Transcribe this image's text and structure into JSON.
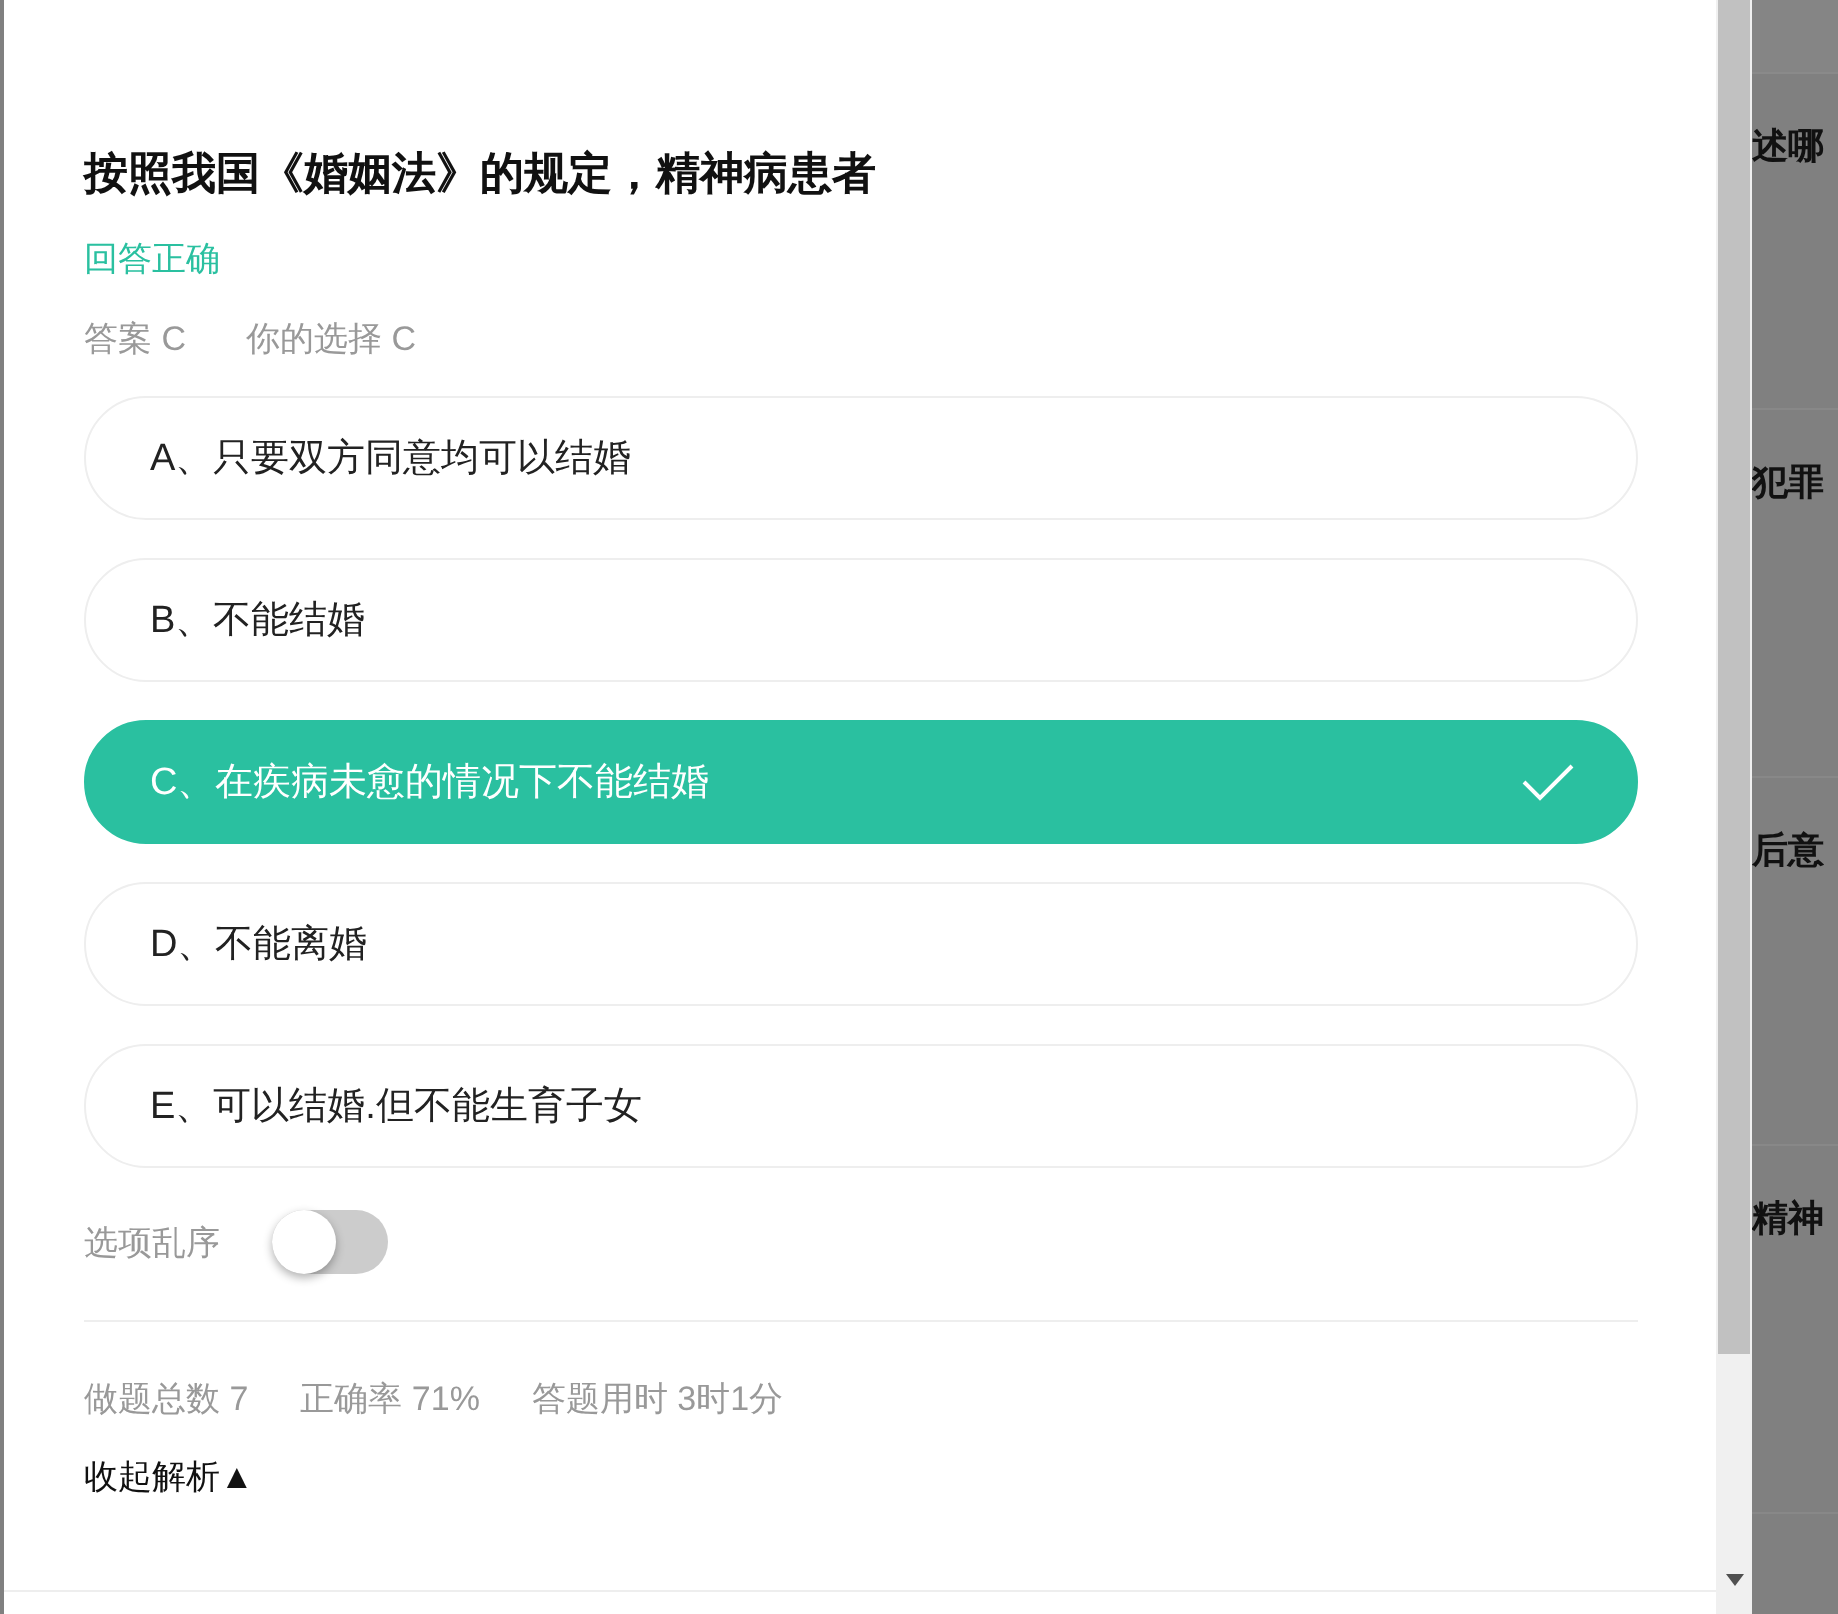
{
  "question": {
    "title": "按照我国《婚姻法》的规定，精神病患者",
    "result": "回答正确",
    "answer": "答案 C",
    "your_choice": "你的选择 C"
  },
  "options": [
    {
      "label": "A、只要双方同意均可以结婚",
      "selected": false
    },
    {
      "label": "B、不能结婚",
      "selected": false
    },
    {
      "label": "C、在疾病未愈的情况下不能结婚",
      "selected": true
    },
    {
      "label": "D、不能离婚",
      "selected": false
    },
    {
      "label": "E、可以结婚.但不能生育子女",
      "selected": false
    }
  ],
  "shuffle_toggle": {
    "label": "选项乱序",
    "on": false
  },
  "stats": [
    "做题总数 7",
    "正确率 71%",
    "答题用时 3时1分"
  ],
  "analysis_toggle": "收起解析▲",
  "background_list": [
    "述哪",
    "犯罪",
    "后意",
    "精神"
  ]
}
